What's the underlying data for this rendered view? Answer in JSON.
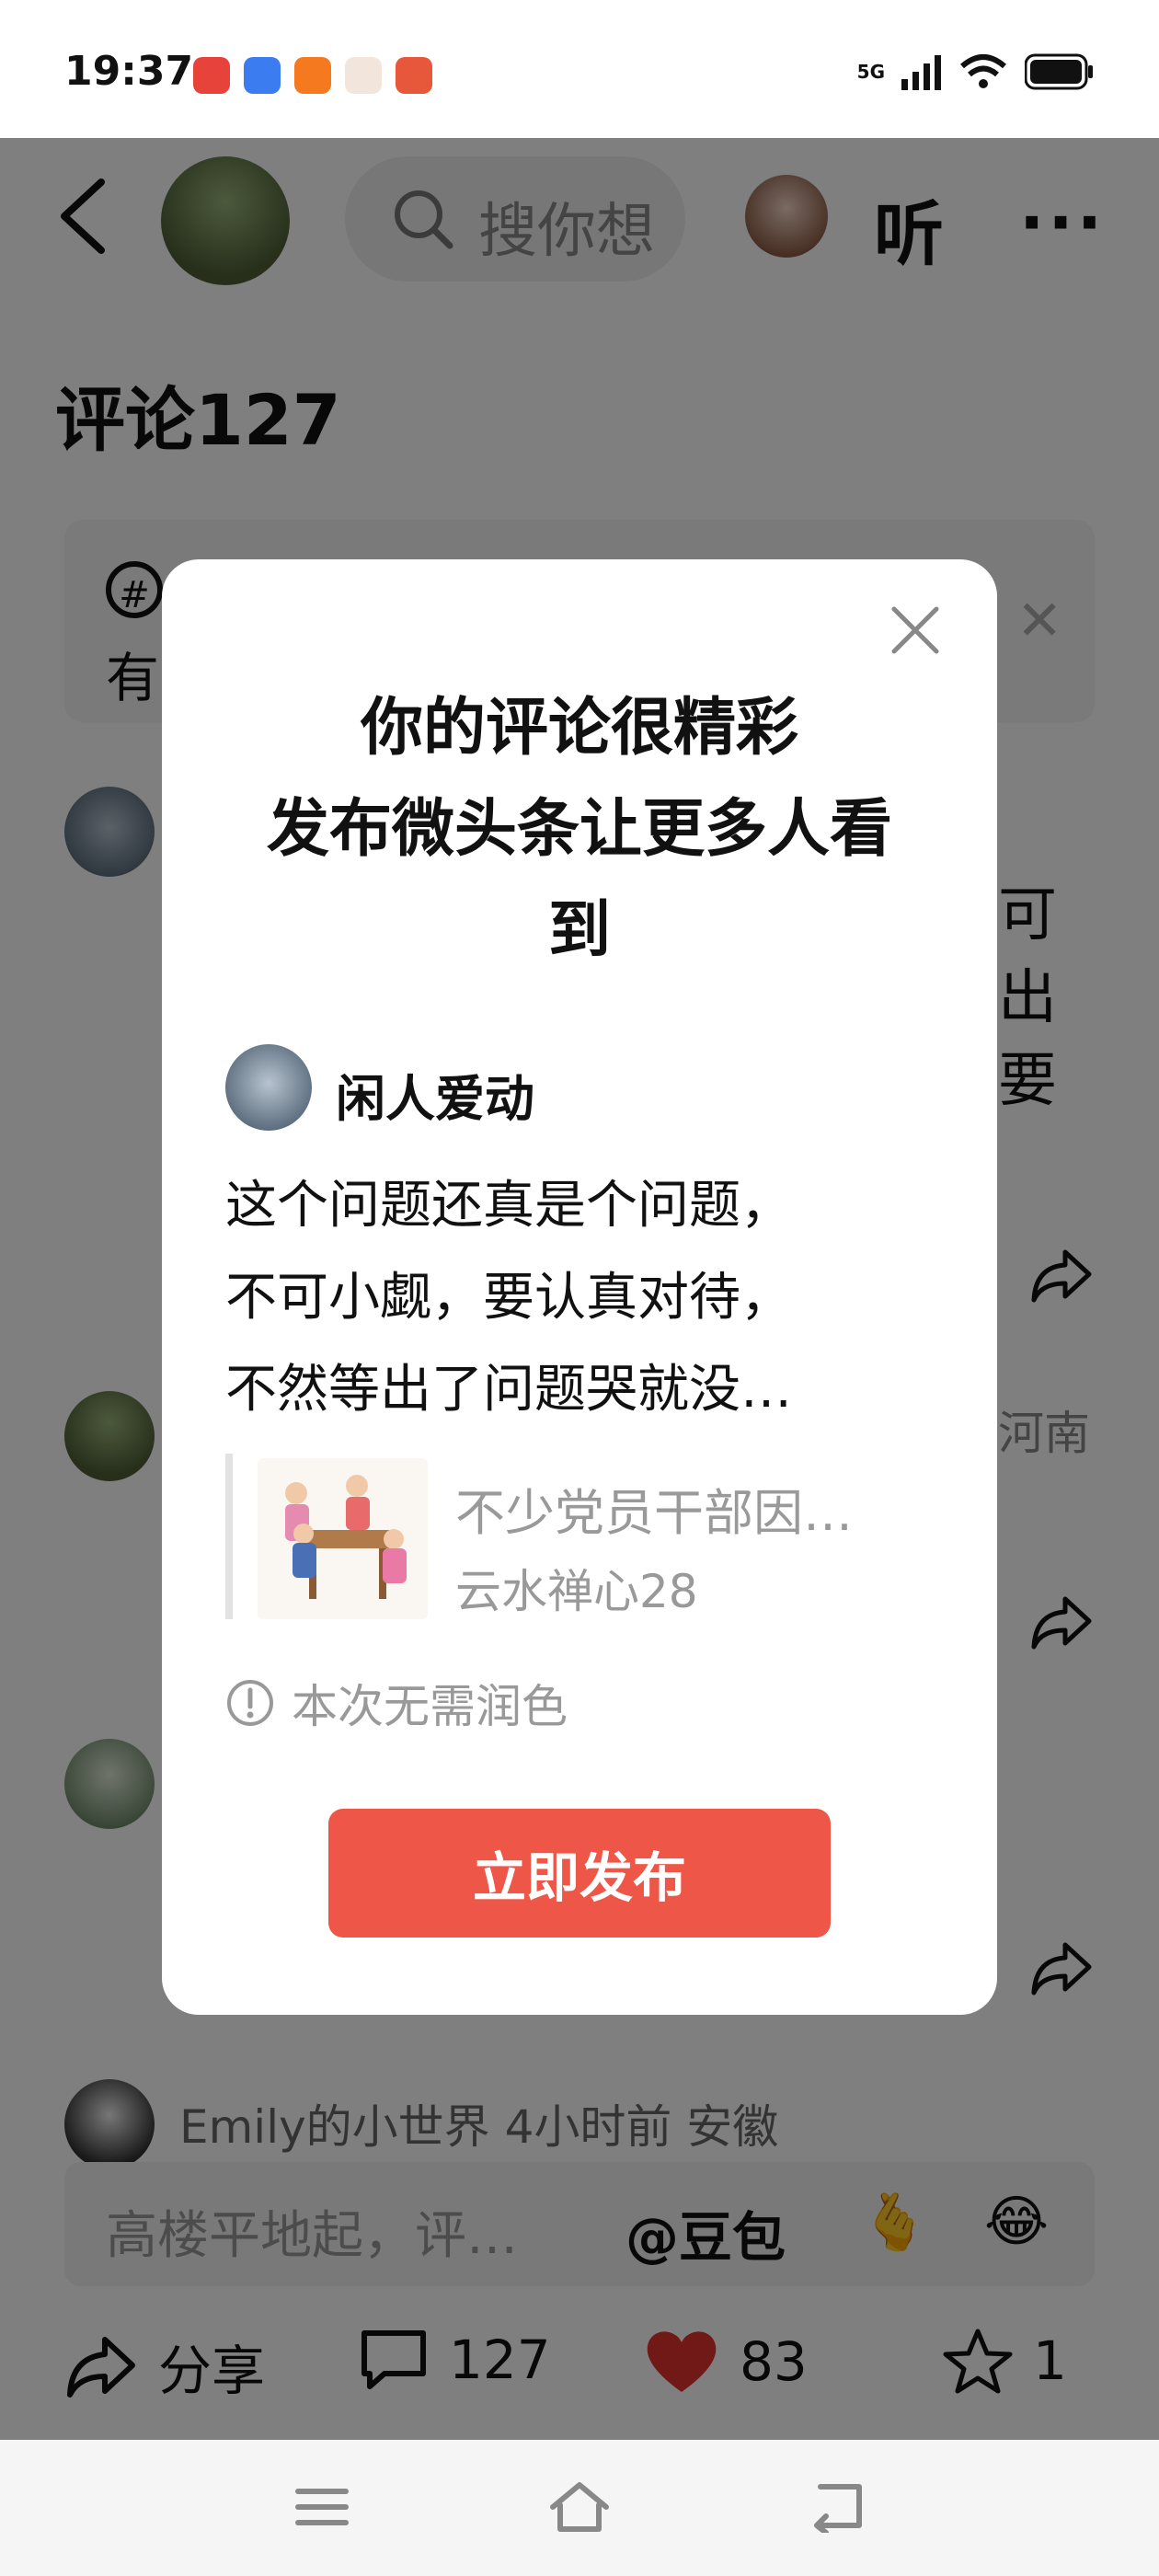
{
  "status_bar": {
    "time": "19:37",
    "network": "5G"
  },
  "nav": {
    "search_placeholder": "搜你想",
    "listen_label": "听",
    "more_label": "···"
  },
  "comments": {
    "title": "评论127",
    "side_text": [
      "可",
      "出",
      "要"
    ],
    "location": "河南",
    "last_comment_meta": "Emily的小世界  4小时前  安徽"
  },
  "comment_input": {
    "placeholder": "高楼平地起，评…",
    "mention_label": "@豆包"
  },
  "bottom_bar": {
    "share_label": "分享",
    "comment_count": "127",
    "like_count": "83",
    "favorite_count": "1"
  },
  "modal": {
    "title_lines": [
      "你的评论很精彩",
      "发布微头条让更多人看",
      "到"
    ],
    "post": {
      "author": "闲人爱动",
      "lines": [
        "这个问题还真是个问题，",
        "不可小觑，要认真对待，",
        "不然等出了问题哭就没…"
      ]
    },
    "quote": {
      "title": "不少党员干部因…",
      "author": "云水禅心28"
    },
    "notice": "本次无需润色",
    "publish_button": "立即发布"
  },
  "colors": {
    "accent": "#ee5648",
    "like": "#e0322c"
  }
}
